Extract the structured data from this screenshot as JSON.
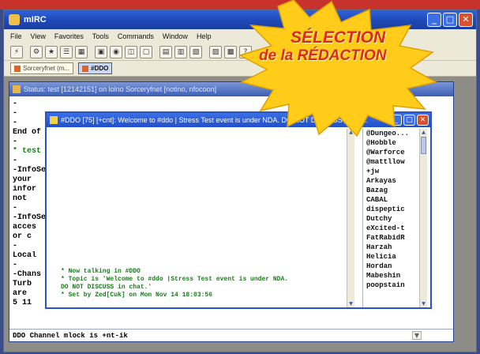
{
  "app": {
    "title": "mIRC",
    "window_buttons": [
      "_",
      "□",
      "✕"
    ]
  },
  "menubar": [
    "File",
    "View",
    "Favorites",
    "Tools",
    "Commands",
    "Window",
    "Help"
  ],
  "switchbar": [
    {
      "label": "Sorceryfnet (m...",
      "active": false
    },
    {
      "label": "#DDO",
      "active": true
    }
  ],
  "status_window": {
    "title": "Status: test [12142151] on lolno Sorceryfnet [notino, nfocoon]",
    "lines": [
      "-",
      "-",
      "-",
      "End of",
      "-",
      "* test",
      "-",
      "-InfoSe",
      "your",
      "infor",
      "not",
      "-",
      "-InfoSe",
      "acces",
      "or c",
      "-",
      "Local",
      "-",
      "-Chans",
      "Turb",
      "are",
      "5 11"
    ],
    "input": "DDO Channel mlock is +nt-ik"
  },
  "channel_window": {
    "title": "#DDO [75] [+cnt]: Welcome to #ddo | Stress Test event is under NDA. DO NOT DISCUSS in chat.",
    "lines": [
      "* Now talking in #DDO",
      "* Topic is 'Welcome to #ddo |Stress Test event is under NDA.",
      "DO NOT DISCUSS in chat.'",
      "* Set by Zed[Cuk] on Mon Nov 14 18:03:56"
    ],
    "nicks": [
      "@Dungeo...",
      "@Hobble",
      "@Warforce",
      "@mattllow",
      "+jw",
      "Arkayas",
      "Bazag",
      "CABAL",
      "dispeptic",
      "Dutchy",
      "eXcited-t",
      "FatRabidR",
      "Harzah",
      "Helicia",
      "Hordan",
      "Mabeshin",
      "poopstain"
    ]
  },
  "badge": {
    "line1": "SÉLECTION",
    "line2": "de la RÉDACTION",
    "color": "#ffcc1a",
    "text_color": "#d92a1e"
  },
  "colors": {
    "titlebar": "#2250c8",
    "channel_text": "#1c7a1c",
    "page_banner": "#c8322c"
  }
}
